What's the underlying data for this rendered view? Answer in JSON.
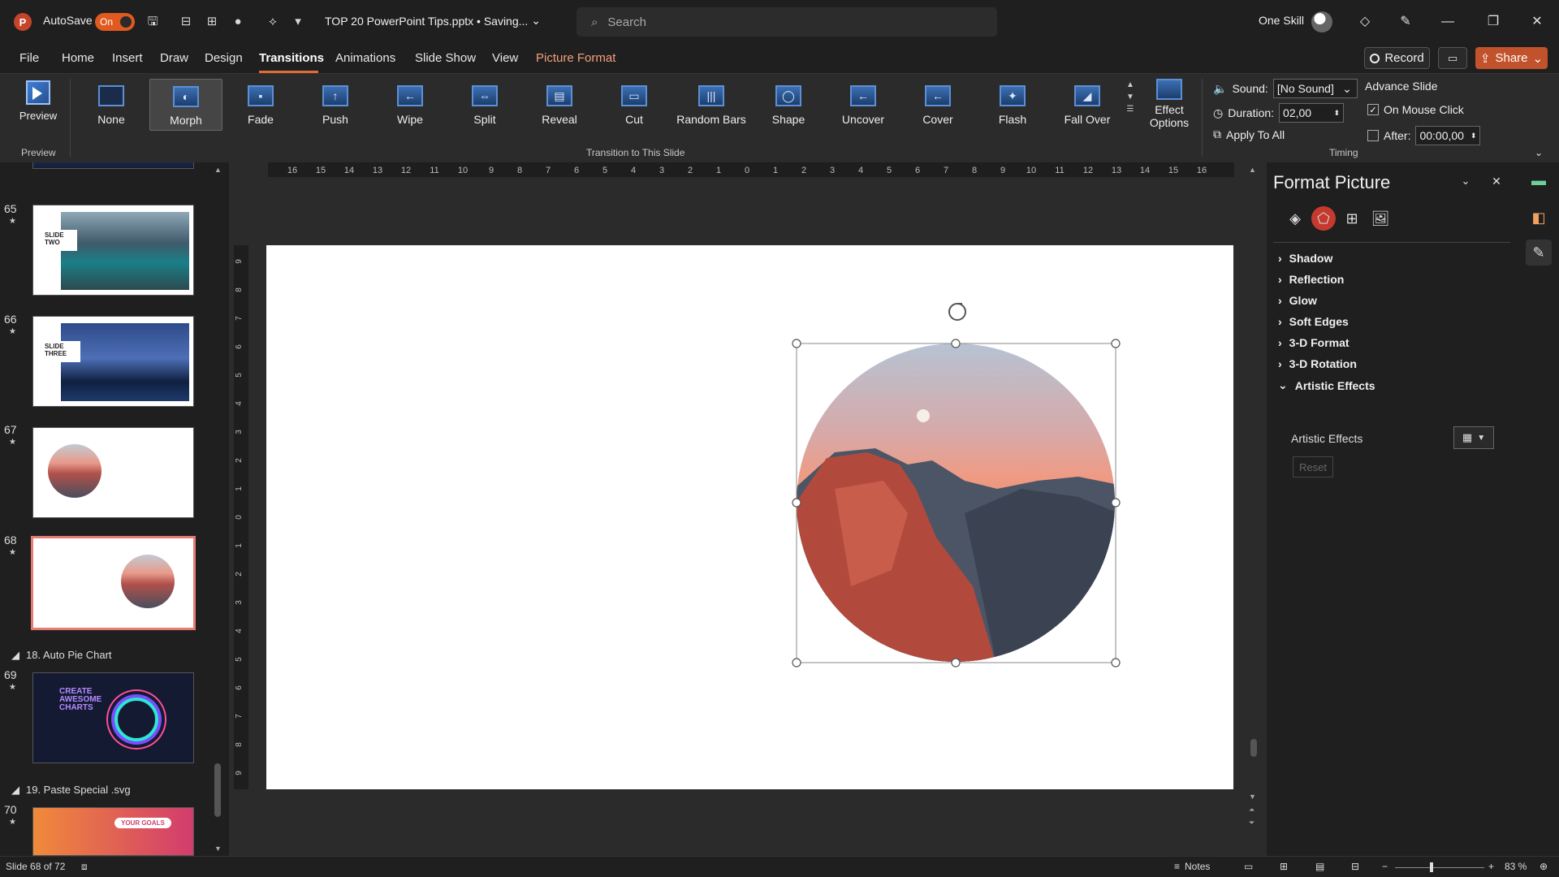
{
  "titlebar": {
    "app_logo": "P",
    "autosave_label": "AutoSave",
    "autosave_state": "On",
    "doc_title": "TOP 20 PowerPoint Tips.pptx • Saving...",
    "search_placeholder": "Search",
    "user_name": "One Skill"
  },
  "menu": {
    "items": [
      "File",
      "Home",
      "Insert",
      "Draw",
      "Design",
      "Transitions",
      "Animations",
      "Slide Show",
      "View",
      "Picture Format"
    ],
    "active": "Transitions",
    "record_label": "Record",
    "share_label": "Share"
  },
  "ribbon": {
    "preview_label": "Preview",
    "preview_group": "Preview",
    "transitions": [
      {
        "label": "None",
        "sym": ""
      },
      {
        "label": "Morph",
        "sym": "◐"
      },
      {
        "label": "Fade",
        "sym": "▪"
      },
      {
        "label": "Push",
        "sym": "↑"
      },
      {
        "label": "Wipe",
        "sym": "←"
      },
      {
        "label": "Split",
        "sym": "⇔"
      },
      {
        "label": "Reveal",
        "sym": "▤"
      },
      {
        "label": "Cut",
        "sym": "▭"
      },
      {
        "label": "Random Bars",
        "sym": "|||"
      },
      {
        "label": "Shape",
        "sym": "◯"
      },
      {
        "label": "Uncover",
        "sym": "←"
      },
      {
        "label": "Cover",
        "sym": "←"
      },
      {
        "label": "Flash",
        "sym": "✦"
      },
      {
        "label": "Fall Over",
        "sym": "◢"
      }
    ],
    "selected_transition": "Morph",
    "transition_group": "Transition to This Slide",
    "effect_options_label": "Effect Options",
    "sound_label": "Sound:",
    "sound_value": "[No Sound]",
    "duration_label": "Duration:",
    "duration_value": "02,00",
    "apply_all_label": "Apply To All",
    "advance_slide_label": "Advance Slide",
    "on_mouse_click_label": "On Mouse Click",
    "on_mouse_click_checked": true,
    "after_label": "After:",
    "after_value": "00:00,00",
    "after_checked": false,
    "timing_group": "Timing"
  },
  "thumbnails": {
    "slides": [
      {
        "num": "65",
        "title_line1": "SLIDE",
        "title_line2": "TWO"
      },
      {
        "num": "66",
        "title_line1": "SLIDE",
        "title_line2": "THREE"
      },
      {
        "num": "67"
      },
      {
        "num": "68",
        "selected": true
      }
    ],
    "section_18": "18. Auto Pie Chart",
    "slide_69": {
      "num": "69",
      "text_line1": "CREATE",
      "text_line2": "AWESOME",
      "text_line3": "CHARTS"
    },
    "section_19": "19. Paste Special .svg",
    "slide_70": {
      "num": "70",
      "badge": "YOUR GOALS"
    }
  },
  "ruler": {
    "h_labels": [
      "16",
      "15",
      "14",
      "13",
      "12",
      "11",
      "10",
      "9",
      "8",
      "7",
      "6",
      "5",
      "4",
      "3",
      "2",
      "1",
      "0",
      "1",
      "2",
      "3",
      "4",
      "5",
      "6",
      "7",
      "8",
      "9",
      "10",
      "11",
      "12",
      "13",
      "14",
      "15",
      "16"
    ],
    "v_labels": [
      "9",
      "8",
      "7",
      "6",
      "5",
      "4",
      "3",
      "2",
      "1",
      "0",
      "1",
      "2",
      "3",
      "4",
      "5",
      "6",
      "7",
      "8",
      "9"
    ]
  },
  "format_picture": {
    "title": "Format Picture",
    "sections": [
      {
        "label": "Shadow",
        "expanded": false
      },
      {
        "label": "Reflection",
        "expanded": false
      },
      {
        "label": "Glow",
        "expanded": false
      },
      {
        "label": "Soft Edges",
        "expanded": false
      },
      {
        "label": "3-D Format",
        "expanded": false
      },
      {
        "label": "3-D Rotation",
        "expanded": false
      },
      {
        "label": "Artistic Effects",
        "expanded": true
      }
    ],
    "artistic_effects_label": "Artistic Effects",
    "reset_label": "Reset"
  },
  "statusbar": {
    "slide_info": "Slide 68 of 72",
    "notes_label": "Notes",
    "zoom": "83 %"
  },
  "colors": {
    "accent": "#e06b36",
    "share": "#c2522b",
    "selected_thumb_border": "#e57b74",
    "fill_tab": "#c53a2e"
  }
}
